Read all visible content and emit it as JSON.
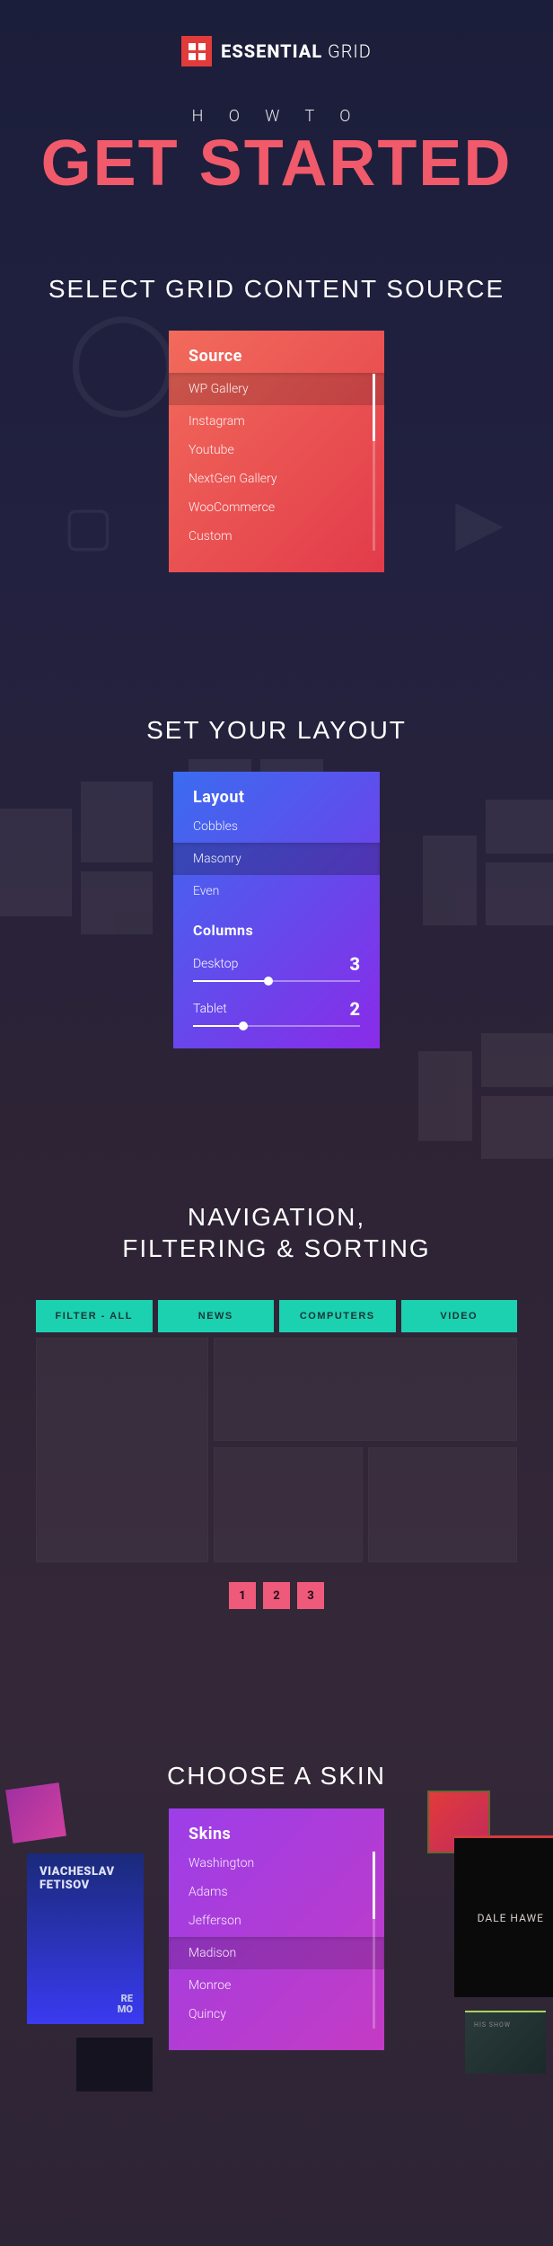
{
  "logo": {
    "brand_bold": "ESSENTIAL",
    "brand_light": " GRID"
  },
  "hero": {
    "kicker": "H O W  T O",
    "title": "GET STARTED"
  },
  "section_source": {
    "title": "SELECT GRID CONTENT SOURCE",
    "panel_title": "Source",
    "items": [
      "WP Gallery",
      "Instagram",
      "Youtube",
      "NextGen Gallery",
      "WooCommerce",
      "Custom"
    ],
    "selected": "WP Gallery"
  },
  "section_layout": {
    "title": "SET YOUR LAYOUT",
    "panel_title": "Layout",
    "items": [
      "Cobbles",
      "Masonry",
      "Even"
    ],
    "selected": "Masonry",
    "columns_title": "Columns",
    "sliders": [
      {
        "label": "Desktop",
        "value": "3",
        "percent": 45
      },
      {
        "label": "Tablet",
        "value": "2",
        "percent": 30
      }
    ]
  },
  "section_nav": {
    "title_line1": "NAVIGATION,",
    "title_line2": "FILTERING & SORTING",
    "filters": [
      "FILTER - ALL",
      "NEWS",
      "COMPUTERS",
      "VIDEO"
    ],
    "pages": [
      "1",
      "2",
      "3"
    ]
  },
  "section_skin": {
    "title": "CHOOSE A SKIN",
    "panel_title": "Skins",
    "items": [
      "Washington",
      "Adams",
      "Jefferson",
      "Madison",
      "Monroe",
      "Quincy"
    ],
    "selected": "Madison",
    "card_left_title": "VIACHESLAV\nFETISOV",
    "card_left_more": "RE\nMO",
    "card_right_title": "DALE HAWE"
  }
}
